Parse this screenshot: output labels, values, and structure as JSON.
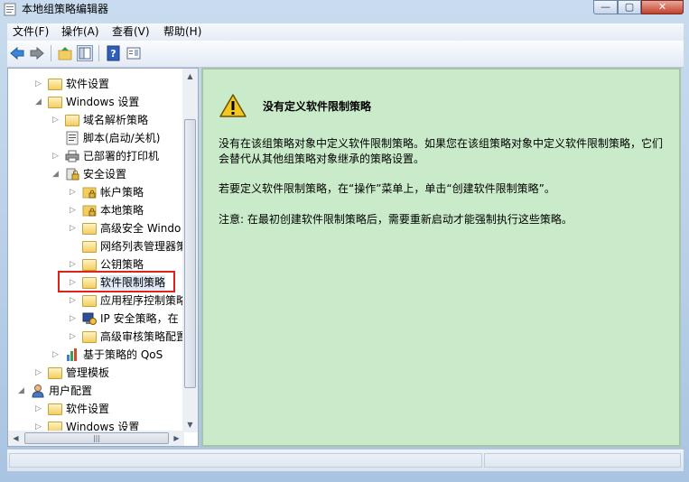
{
  "window": {
    "title": "本地组策略编辑器",
    "controls": {
      "minimize": "—",
      "maximize": "▢",
      "close": "✕"
    }
  },
  "menu": [
    {
      "label": "文件(F)"
    },
    {
      "label": "操作(A)"
    },
    {
      "label": "查看(V)"
    },
    {
      "label": "帮助(H)"
    }
  ],
  "toolbar": {
    "buttons": [
      "back-arrow-icon",
      "forward-arrow-icon",
      "up-folder-icon",
      "show-hide-tree-icon",
      "help-icon",
      "properties-icon"
    ]
  },
  "tree": {
    "items": [
      {
        "label": "软件设置",
        "expander": "▷",
        "icon": "folder-icon"
      },
      {
        "label": "Windows 设置",
        "expander": "◢",
        "icon": "folder-icon"
      },
      {
        "label": "域名解析策略",
        "expander": "▷",
        "icon": "folder-icon"
      },
      {
        "label": "脚本(启动/关机)",
        "expander": "",
        "icon": "script-icon"
      },
      {
        "label": "已部署的打印机",
        "expander": "▷",
        "icon": "printer-icon"
      },
      {
        "label": "安全设置",
        "expander": "◢",
        "icon": "security-icon"
      },
      {
        "label": "帐户策略",
        "expander": "▷",
        "icon": "locked-folder-icon"
      },
      {
        "label": "本地策略",
        "expander": "▷",
        "icon": "locked-folder-icon"
      },
      {
        "label": "高级安全 Windo",
        "expander": "▷",
        "icon": "folder-icon"
      },
      {
        "label": "网络列表管理器策",
        "expander": "",
        "icon": "folder-icon"
      },
      {
        "label": "公钥策略",
        "expander": "▷",
        "icon": "folder-icon"
      },
      {
        "label": "软件限制策略",
        "expander": "▷",
        "icon": "folder-icon"
      },
      {
        "label": "应用程序控制策略",
        "expander": "▷",
        "icon": "folder-icon"
      },
      {
        "label": "IP 安全策略，在",
        "expander": "▷",
        "icon": "ip-security-icon"
      },
      {
        "label": "高级审核策略配置",
        "expander": "▷",
        "icon": "folder-icon"
      },
      {
        "label": "基于策略的 QoS",
        "expander": "▷",
        "icon": "qos-chart-icon"
      },
      {
        "label": "管理模板",
        "expander": "▷",
        "icon": "folder-icon"
      },
      {
        "label": "用户配置",
        "expander": "◢",
        "icon": "user-icon"
      },
      {
        "label": "软件设置",
        "expander": "▷",
        "icon": "folder-icon"
      },
      {
        "label": "Windows 设置",
        "expander": "▷",
        "icon": "folder-icon"
      }
    ]
  },
  "content": {
    "heading": "没有定义软件限制策略",
    "paragraph1": "没有在该组策略对象中定义软件限制策略。如果您在该组策略对象中定义软件限制策略，它们会替代从其他组策略对象继承的策略设置。",
    "paragraph2": "若要定义软件限制策略，在“操作”菜单上，单击“创建软件限制策略”。",
    "paragraph3": "注意: 在最初创建软件限制策略后，需要重新启动才能强制执行这些策略。"
  },
  "colors": {
    "content_background": "#c9ebc9",
    "highlight_border": "#e0231a"
  }
}
